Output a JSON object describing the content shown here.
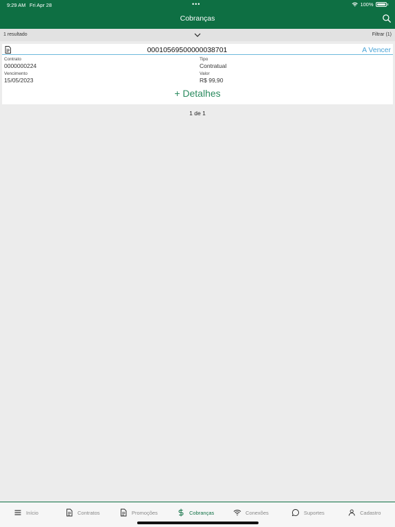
{
  "status_bar": {
    "time": "9:29 AM",
    "date": "Fri Apr 28",
    "dots": "•••",
    "battery": "100%"
  },
  "header": {
    "title": "Cobranças",
    "search_icon": "search-icon"
  },
  "results_bar": {
    "count": "1 resultado",
    "filter": "Filtrar (1)"
  },
  "card": {
    "number": "00010569500000038701",
    "status": "A Vencer",
    "contract_label": "Contrato",
    "contract_value": "0000000224",
    "type_label": "Tipo",
    "type_value": "Contratual",
    "due_label": "Vencimento",
    "due_value": "15/05/2023",
    "amount_label": "Valor",
    "amount_value": "R$ 99,90",
    "details": "+ Detalhes"
  },
  "pagination": "1 de 1",
  "tabs": [
    {
      "label": "Início",
      "icon": "menu-icon",
      "active": false
    },
    {
      "label": "Contratos",
      "icon": "document-icon",
      "active": false
    },
    {
      "label": "Promoções",
      "icon": "document-icon",
      "active": false
    },
    {
      "label": "Cobranças",
      "icon": "dollar-icon",
      "active": true
    },
    {
      "label": "Conexões",
      "icon": "wifi-icon",
      "active": false
    },
    {
      "label": "Suportes",
      "icon": "chat-icon",
      "active": false
    },
    {
      "label": "Cadastro",
      "icon": "user-icon",
      "active": false
    }
  ],
  "colors": {
    "brand": "#0e6f43",
    "status_blue": "#4aa3d6",
    "details_green": "#2a8a5e"
  }
}
